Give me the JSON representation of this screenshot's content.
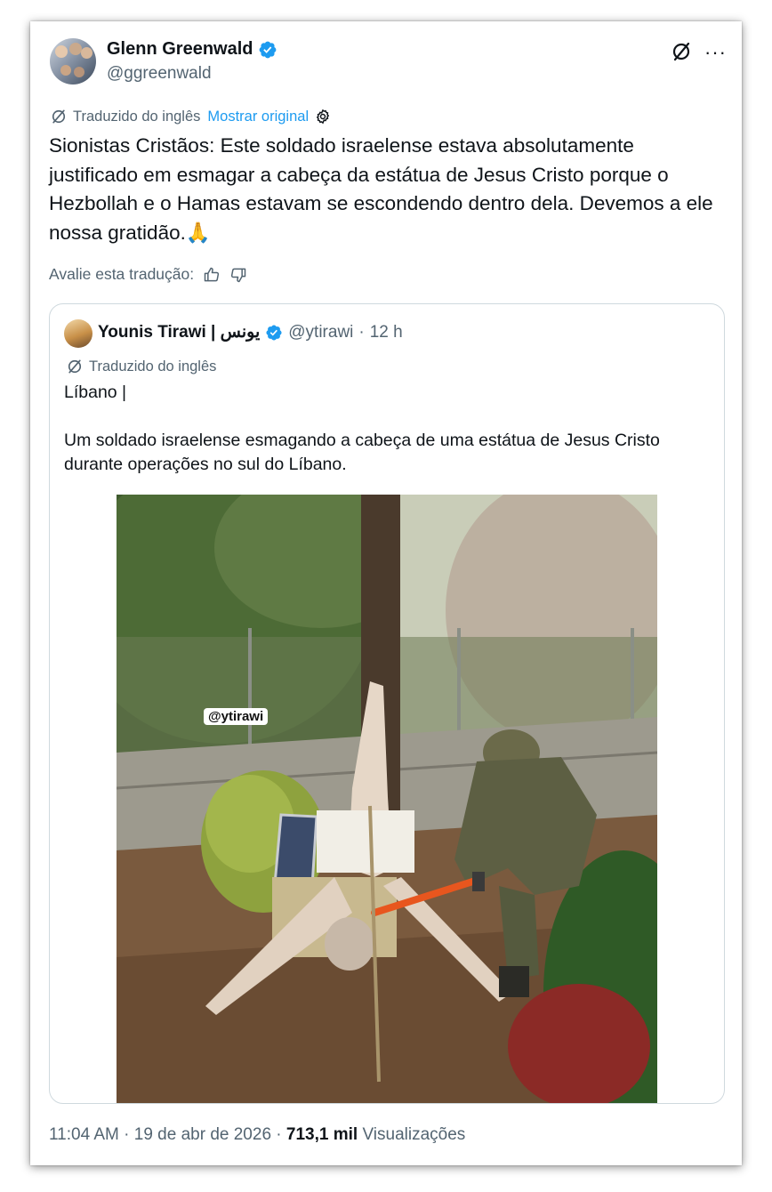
{
  "author": {
    "name": "Glenn Greenwald",
    "handle": "@ggreenwald",
    "verified": true
  },
  "translation": {
    "label": "Traduzido do inglês",
    "show_original": "Mostrar original"
  },
  "post_text": "Sionistas Cristãos: Este soldado israelense estava absolutamente justificado em esmagar a cabeça da estátua de Jesus Cristo porque o Hezbollah e o Hamas estavam se escondendo dentro dela. Devemos a ele nossa gratidão.🙏",
  "rate_translation": "Avalie esta tradução:",
  "quoted": {
    "name": "Younis Tirawi | يونس",
    "handle": "@ytirawi",
    "separator": "·",
    "time": "12 h",
    "translated_label": "Traduzido do inglês",
    "text": "Líbano |\n\nUm soldado israelense esmagando a cabeça de uma estátua de Jesus Cristo durante operações no sul do Líbano.",
    "image_watermark": "@ytirawi"
  },
  "footer": {
    "time": "11:04 AM",
    "sep1": "·",
    "date": "19 de abr de 2026",
    "sep2": "·",
    "views_count": "713,1 mil",
    "views_label": "Visualizações"
  },
  "colors": {
    "accent": "#1d9bf0",
    "secondary_text": "#536471",
    "border": "#cfd9de"
  },
  "icons": [
    "verified-badge-icon",
    "grok-icon",
    "more-icon",
    "translate-icon",
    "settings-gear-icon",
    "thumbs-up-icon",
    "thumbs-down-icon"
  ]
}
